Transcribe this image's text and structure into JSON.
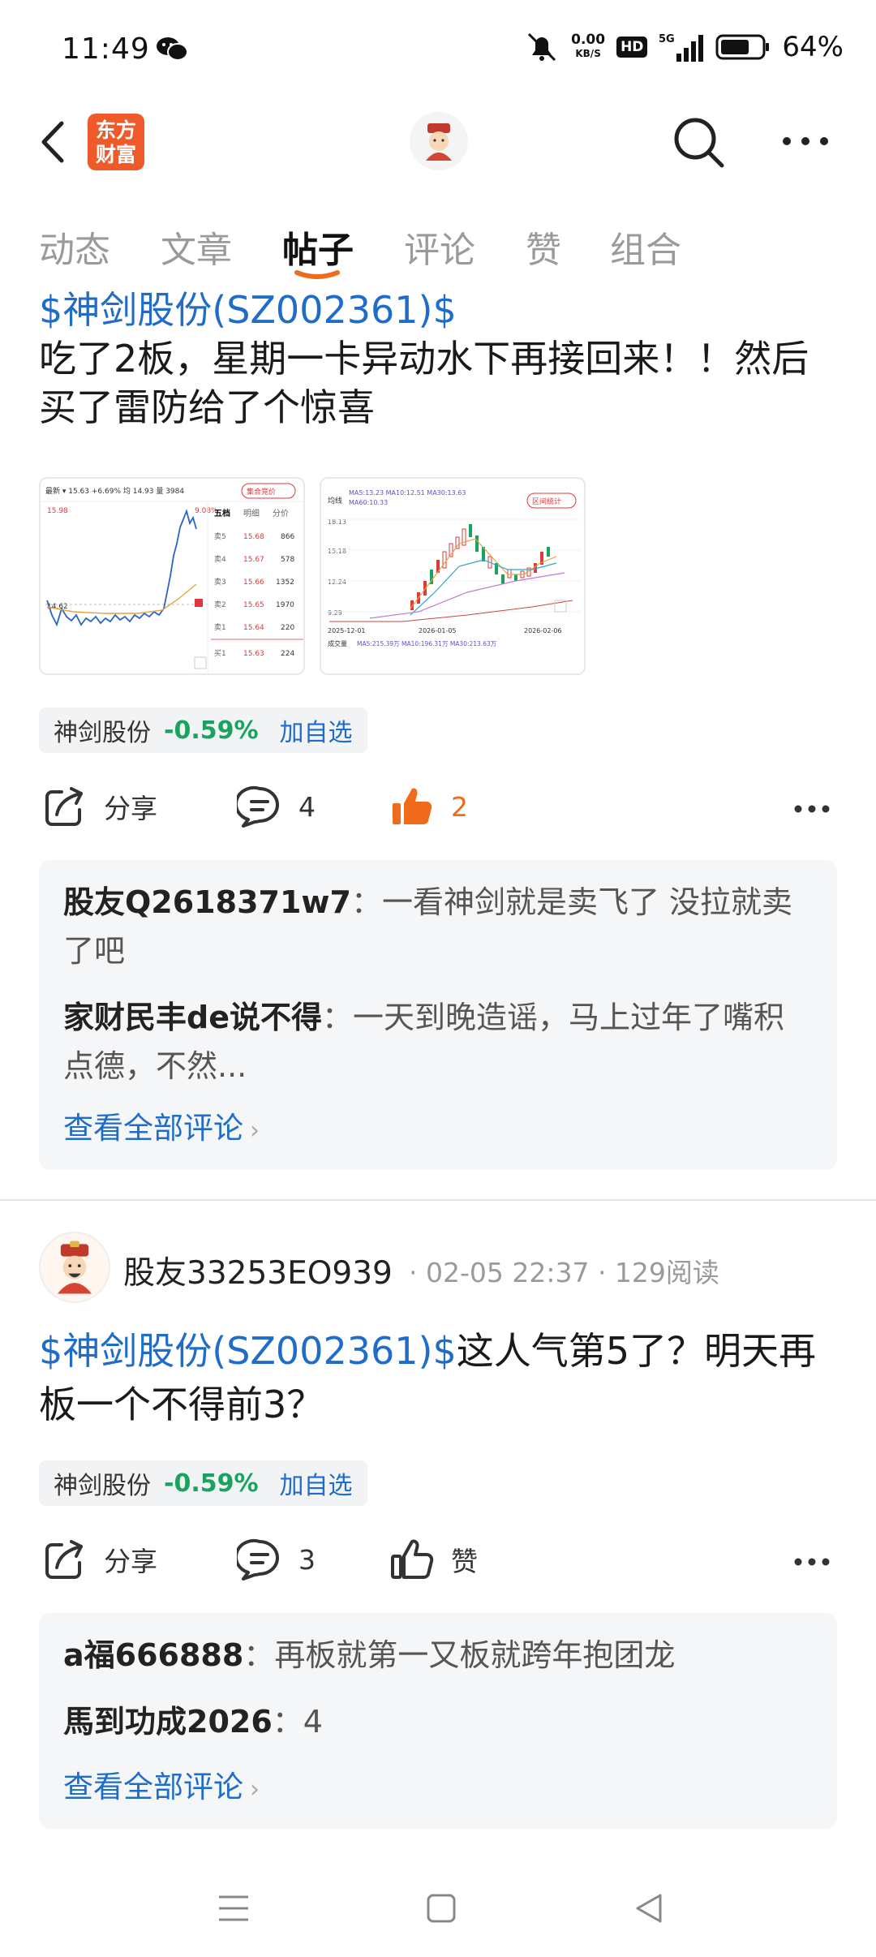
{
  "status_bar": {
    "time": "11:49",
    "net_speed_value": "0.00",
    "net_speed_unit": "KB/S",
    "hd_label": "HD",
    "network_type": "5G",
    "battery_pct": "64%"
  },
  "header": {
    "brand_line1": "东方",
    "brand_line2": "财富"
  },
  "tabs": [
    {
      "label": "动态"
    },
    {
      "label": "文章"
    },
    {
      "label": "帖子"
    },
    {
      "label": "评论"
    },
    {
      "label": "赞"
    },
    {
      "label": "组合"
    }
  ],
  "active_tab": "帖子",
  "post1": {
    "stock_link": "$神剑股份(SZ002361)$",
    "text": "吃了2板，星期一卡异动水下再接回来！！然后买了雷防给了个惊喜",
    "thumb1": {
      "header": "最新 ▾  15.63  +6.69%  均 14.93  量 3984",
      "badge": "集合竞价",
      "price_top": "15.98",
      "price_pct": "9.08%",
      "price_mid": "14.62",
      "side_tabs": [
        "五档",
        "明细",
        "分价"
      ],
      "order_book": [
        {
          "label": "卖5",
          "price": "15.68",
          "vol": "866"
        },
        {
          "label": "卖4",
          "price": "15.67",
          "vol": "578"
        },
        {
          "label": "卖3",
          "price": "15.66",
          "vol": "1352"
        },
        {
          "label": "卖2",
          "price": "15.65",
          "vol": "1970"
        },
        {
          "label": "卖1",
          "price": "15.64",
          "vol": "220"
        },
        {
          "label": "买1",
          "price": "15.63",
          "vol": "224"
        }
      ]
    },
    "thumb2": {
      "ma_line1": "MA5:13.23  MA10:12.51  MA30:13.63",
      "ma_line2": "MA60:10.33",
      "badge": "区间统计",
      "type_label": "均线",
      "y_labels": [
        "18.13",
        "15.18",
        "12.24",
        "9.29"
      ],
      "dates": [
        "2025-12-01",
        "2026-01-05",
        "2026-02-06"
      ],
      "vol_label": "成交量",
      "vol_ma": "MA5:215.39万  MA10:196.31万  MA30:213.63万"
    },
    "stock_tag": {
      "name": "神剑股份",
      "change": "-0.59%",
      "add": "加自选"
    },
    "actions": {
      "share": "分享",
      "comments": "4",
      "likes": "2"
    },
    "comments": [
      {
        "user": "股友Q2618371w7",
        "sep": "：",
        "text": "一看神剑就是卖飞了 没拉就卖了吧"
      },
      {
        "user": "家财民丰de说不得",
        "sep": "：",
        "text": "一天到晚造谣，马上过年了嘴积点德，不然..."
      }
    ],
    "view_all": "查看全部评论"
  },
  "post2": {
    "author": "股友33253EO939",
    "meta": "· 02-05 22:37 · 129阅读",
    "stock_link": "$神剑股份(SZ002361)$",
    "text": "这人气第5了？明天再板一个不得前3？",
    "stock_tag": {
      "name": "神剑股份",
      "change": "-0.59%",
      "add": "加自选"
    },
    "actions": {
      "share": "分享",
      "comments": "3",
      "likes": "赞"
    },
    "comments": [
      {
        "user": "a福666888",
        "sep": "：",
        "text": "再板就第一又板就跨年抱团龙"
      },
      {
        "user": "馬到功成2026",
        "sep": "：",
        "text": "4"
      }
    ],
    "view_all": "查看全部评论"
  },
  "colors": {
    "link_blue": "#1f6cc9",
    "brand_orange": "#ef5a2a",
    "like_orange": "#f06a1c",
    "down_green": "#1aa260",
    "chart_red": "#e0373a"
  }
}
